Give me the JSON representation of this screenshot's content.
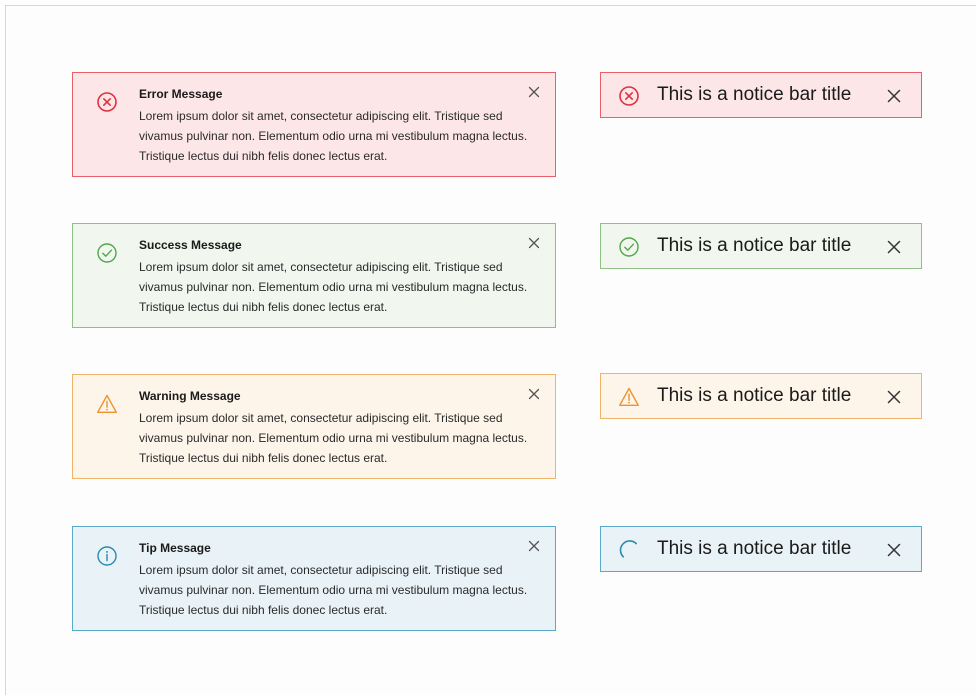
{
  "messages": [
    {
      "type": "error",
      "title": "Error Message",
      "body": "Lorem ipsum dolor sit amet, consectetur adipiscing elit. Tristique sed vivamus pulvinar non. Elementum odio urna mi vestibulum magna lectus. Tristique lectus dui nibh felis donec lectus erat.",
      "icon": "error-circle-x-icon",
      "border_color": "#e8606a",
      "background": "#fde6e7",
      "icon_color": "#e0313f"
    },
    {
      "type": "success",
      "title": "Success Message",
      "body": "Lorem ipsum dolor sit amet, consectetur adipiscing elit. Tristique sed vivamus pulvinar non. Elementum odio urna mi vestibulum magna lectus. Tristique lectus dui nibh felis donec lectus erat.",
      "icon": "success-check-circle-icon",
      "border_color": "#8fbf86",
      "background": "#f1f6ef",
      "icon_color": "#4fa84a"
    },
    {
      "type": "warning",
      "title": "Warning Message",
      "body": "Lorem ipsum dolor sit amet, consectetur adipiscing elit. Tristique sed vivamus pulvinar non. Elementum odio urna mi vestibulum magna lectus. Tristique lectus dui nibh felis donec lectus erat.",
      "icon": "warning-triangle-icon",
      "border_color": "#efb36a",
      "background": "#fdf4ea",
      "icon_color": "#ee9230"
    },
    {
      "type": "tip",
      "title": "Tip Message",
      "body": "Lorem ipsum dolor sit amet, consectetur adipiscing elit. Tristique sed vivamus pulvinar non. Elementum odio urna mi vestibulum magna lectus. Tristique lectus dui nibh felis donec lectus erat.",
      "icon": "info-circle-icon",
      "border_color": "#5aa9c6",
      "background": "#e9f2f6",
      "icon_color": "#2a8ab1"
    }
  ],
  "notice_bars": [
    {
      "type": "error",
      "title": "This is a notice bar title",
      "icon": "error-circle-x-icon",
      "border_color": "#e8606a",
      "background": "#fde6e7",
      "icon_color": "#e0313f"
    },
    {
      "type": "success",
      "title": "This is a notice bar title",
      "icon": "success-check-circle-icon",
      "border_color": "#8fbf86",
      "background": "#f1f6ef",
      "icon_color": "#4fa84a"
    },
    {
      "type": "warning",
      "title": "This is a notice bar title",
      "icon": "warning-triangle-icon",
      "border_color": "#efb36a",
      "background": "#fdf4ea",
      "icon_color": "#ee9230"
    },
    {
      "type": "loading",
      "title": "This is a notice bar title",
      "icon": "loading-spinner-icon",
      "border_color": "#5aa9c6",
      "background": "#e9f2f6",
      "icon_color": "#2a8ab1"
    }
  ]
}
